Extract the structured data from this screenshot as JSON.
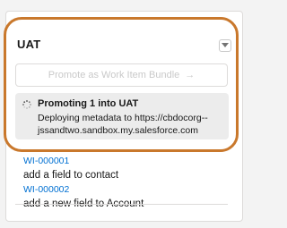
{
  "stage": {
    "title": "UAT"
  },
  "promote_button": {
    "label": "Promote as Work Item Bundle",
    "arrow": "→"
  },
  "status": {
    "title": "Promoting 1 into UAT",
    "detail_line1": "Deploying metadata to https://cbdocorg--",
    "detail_line2": "jssandtwo.sandbox.my.salesforce.com"
  },
  "work_items": [
    {
      "id": "WI-000001",
      "name": "add a field to contact"
    },
    {
      "id": "WI-000002",
      "name": "add a new field to Account"
    }
  ],
  "colors": {
    "highlight": "#c9782c",
    "link": "#0070d2"
  }
}
